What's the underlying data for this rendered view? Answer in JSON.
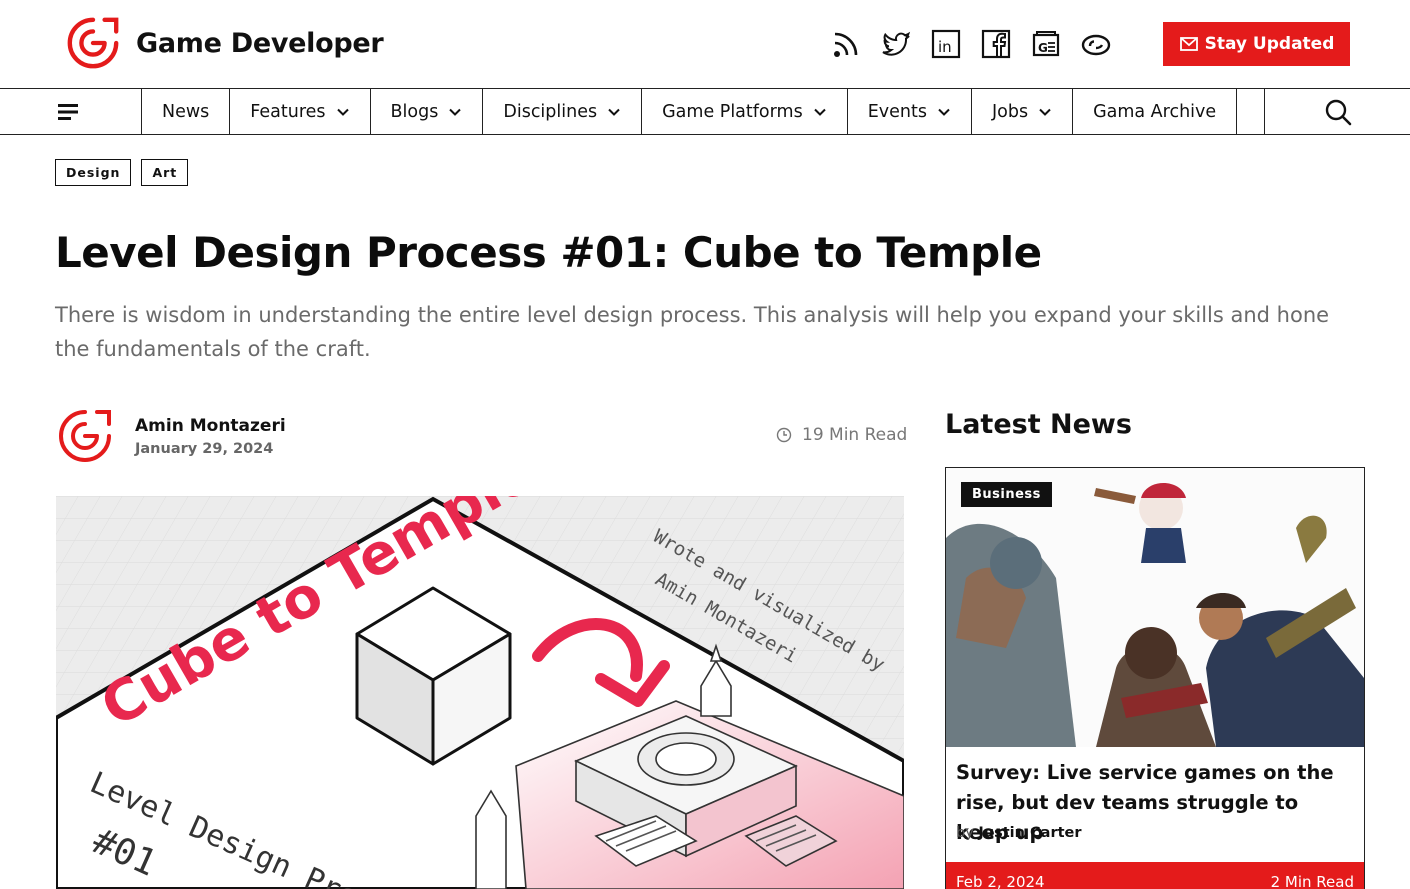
{
  "header": {
    "site_name": "Game Developer",
    "social_icons": [
      "rss-icon",
      "twitter-icon",
      "linkedin-icon",
      "facebook-icon",
      "google-news-icon",
      "flipboard-icon"
    ],
    "cta_label": "Stay Updated",
    "accent_color": "#e41b1b"
  },
  "nav": {
    "items": [
      {
        "label": "News",
        "dropdown": false
      },
      {
        "label": "Features",
        "dropdown": true
      },
      {
        "label": "Blogs",
        "dropdown": true
      },
      {
        "label": "Disciplines",
        "dropdown": true
      },
      {
        "label": "Game Platforms",
        "dropdown": true
      },
      {
        "label": "Events",
        "dropdown": true
      },
      {
        "label": "Jobs",
        "dropdown": true
      },
      {
        "label": "Gama Archive",
        "dropdown": false
      }
    ]
  },
  "article": {
    "tags": [
      "Design",
      "Art"
    ],
    "title": "Level Design Process #01: Cube to Temple",
    "subtitle": "There is wisdom in understanding the entire level design process. This analysis will help you expand your skills and hone the fundamentals of the craft.",
    "author": "Amin Montazeri",
    "date": "January 29, 2024",
    "read_time": "19 Min Read",
    "hero": {
      "headline": "Cube to Temple",
      "credit_line1": "Wrote and visualized by",
      "credit_line2": "Amin Montazeri",
      "series_line1": "Level Design Pro",
      "series_line2": "#01"
    }
  },
  "sidebar": {
    "heading": "Latest News",
    "card": {
      "category": "Business",
      "headline": "Survey: Live service games on the rise, but dev teams struggle to keep up",
      "by_label": "by",
      "author": "Justin Carter",
      "date": "Feb 2, 2024",
      "read_time": "2 Min Read"
    }
  }
}
